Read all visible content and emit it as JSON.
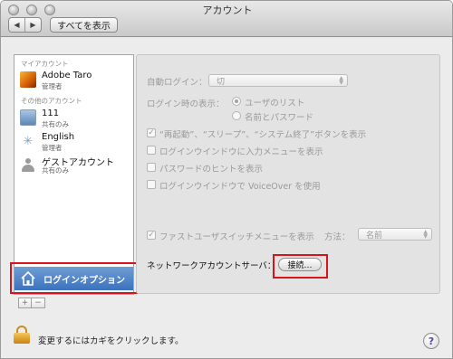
{
  "window": {
    "title": "アカウント"
  },
  "toolbar": {
    "back": "◀",
    "forward": "▶",
    "show_all": "すべてを表示"
  },
  "sidebar": {
    "my_account_header": "マイアカウント",
    "my_account": {
      "name": "Adobe Taro",
      "role": "管理者"
    },
    "other_accounts_header": "その他のアカウント",
    "others": [
      {
        "name": "111",
        "role": "共有のみ"
      },
      {
        "name": "English",
        "role": "管理者"
      },
      {
        "name": "ゲストアカウント",
        "role": "共有のみ"
      }
    ],
    "login_options": "ログインオプション",
    "add": "+",
    "remove": "−"
  },
  "panel": {
    "auto_login_label": "自動ログイン：",
    "auto_login_value": "切",
    "display_label": "ログイン時の表示：",
    "radio_user_list": "ユーザのリスト",
    "radio_name_password": "名前とパスワード",
    "check_buttons": "“再起動”、“スリープ”、“システム終了”ボタンを表示",
    "check_input_menu": "ログインウインドウに入力メニューを表示",
    "check_password_hint": "パスワードのヒントを表示",
    "check_voiceover": "ログインウインドウで VoiceOver を使用",
    "fast_user_switch": "ファストユーザスイッチメニューを表示",
    "method_label": "方法：",
    "method_value": "名前",
    "network_server_label": "ネットワークアカウントサーバ：",
    "connect_button": "接続…",
    "checkmark": "✓"
  },
  "footer": {
    "lock_text": "変更するにはカギをクリックします。",
    "help": "?"
  }
}
